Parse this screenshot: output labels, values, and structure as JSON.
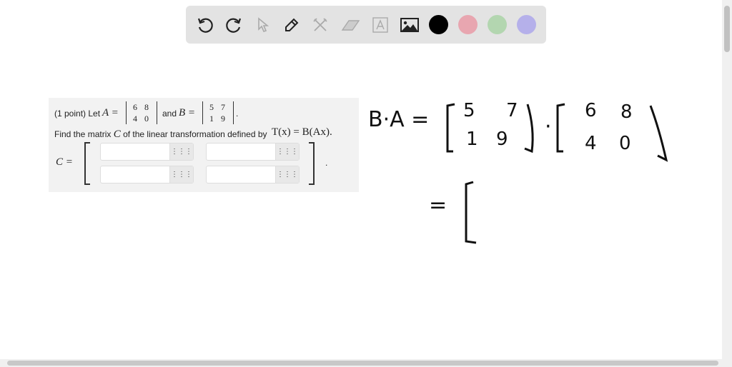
{
  "toolbar": {
    "tools": [
      "undo-icon",
      "redo-icon",
      "select-icon",
      "pen-icon",
      "tools-icon",
      "eraser-icon",
      "text-icon",
      "image-icon"
    ],
    "colors": [
      "#000000",
      "#e8a6b0",
      "#b3d6b0",
      "#b5b0ea"
    ]
  },
  "problem": {
    "intro": "(1 point) Let",
    "A_label": "A =",
    "A": [
      [
        "6",
        "8"
      ],
      [
        "4",
        "0"
      ]
    ],
    "and": "and",
    "B_label": "B =",
    "B": [
      [
        "5",
        "7"
      ],
      [
        "1",
        "9"
      ]
    ],
    "period": ".",
    "line2": "Find the matrix",
    "C": "C",
    "line2b": "of the linear transformation defined by",
    "formula": "T(x) = B(Ax).",
    "C_label": "C =",
    "grid_icon": "⋮⋮⋮",
    "inputs": [
      "",
      "",
      "",
      ""
    ]
  },
  "handwriting": {
    "lhs": "B·A =",
    "M1": [
      [
        "5",
        "7"
      ],
      [
        "1",
        "9"
      ]
    ],
    "dot": "·",
    "M2": [
      [
        "6",
        "8"
      ],
      [
        "4",
        "0"
      ]
    ],
    "eq2": "="
  }
}
